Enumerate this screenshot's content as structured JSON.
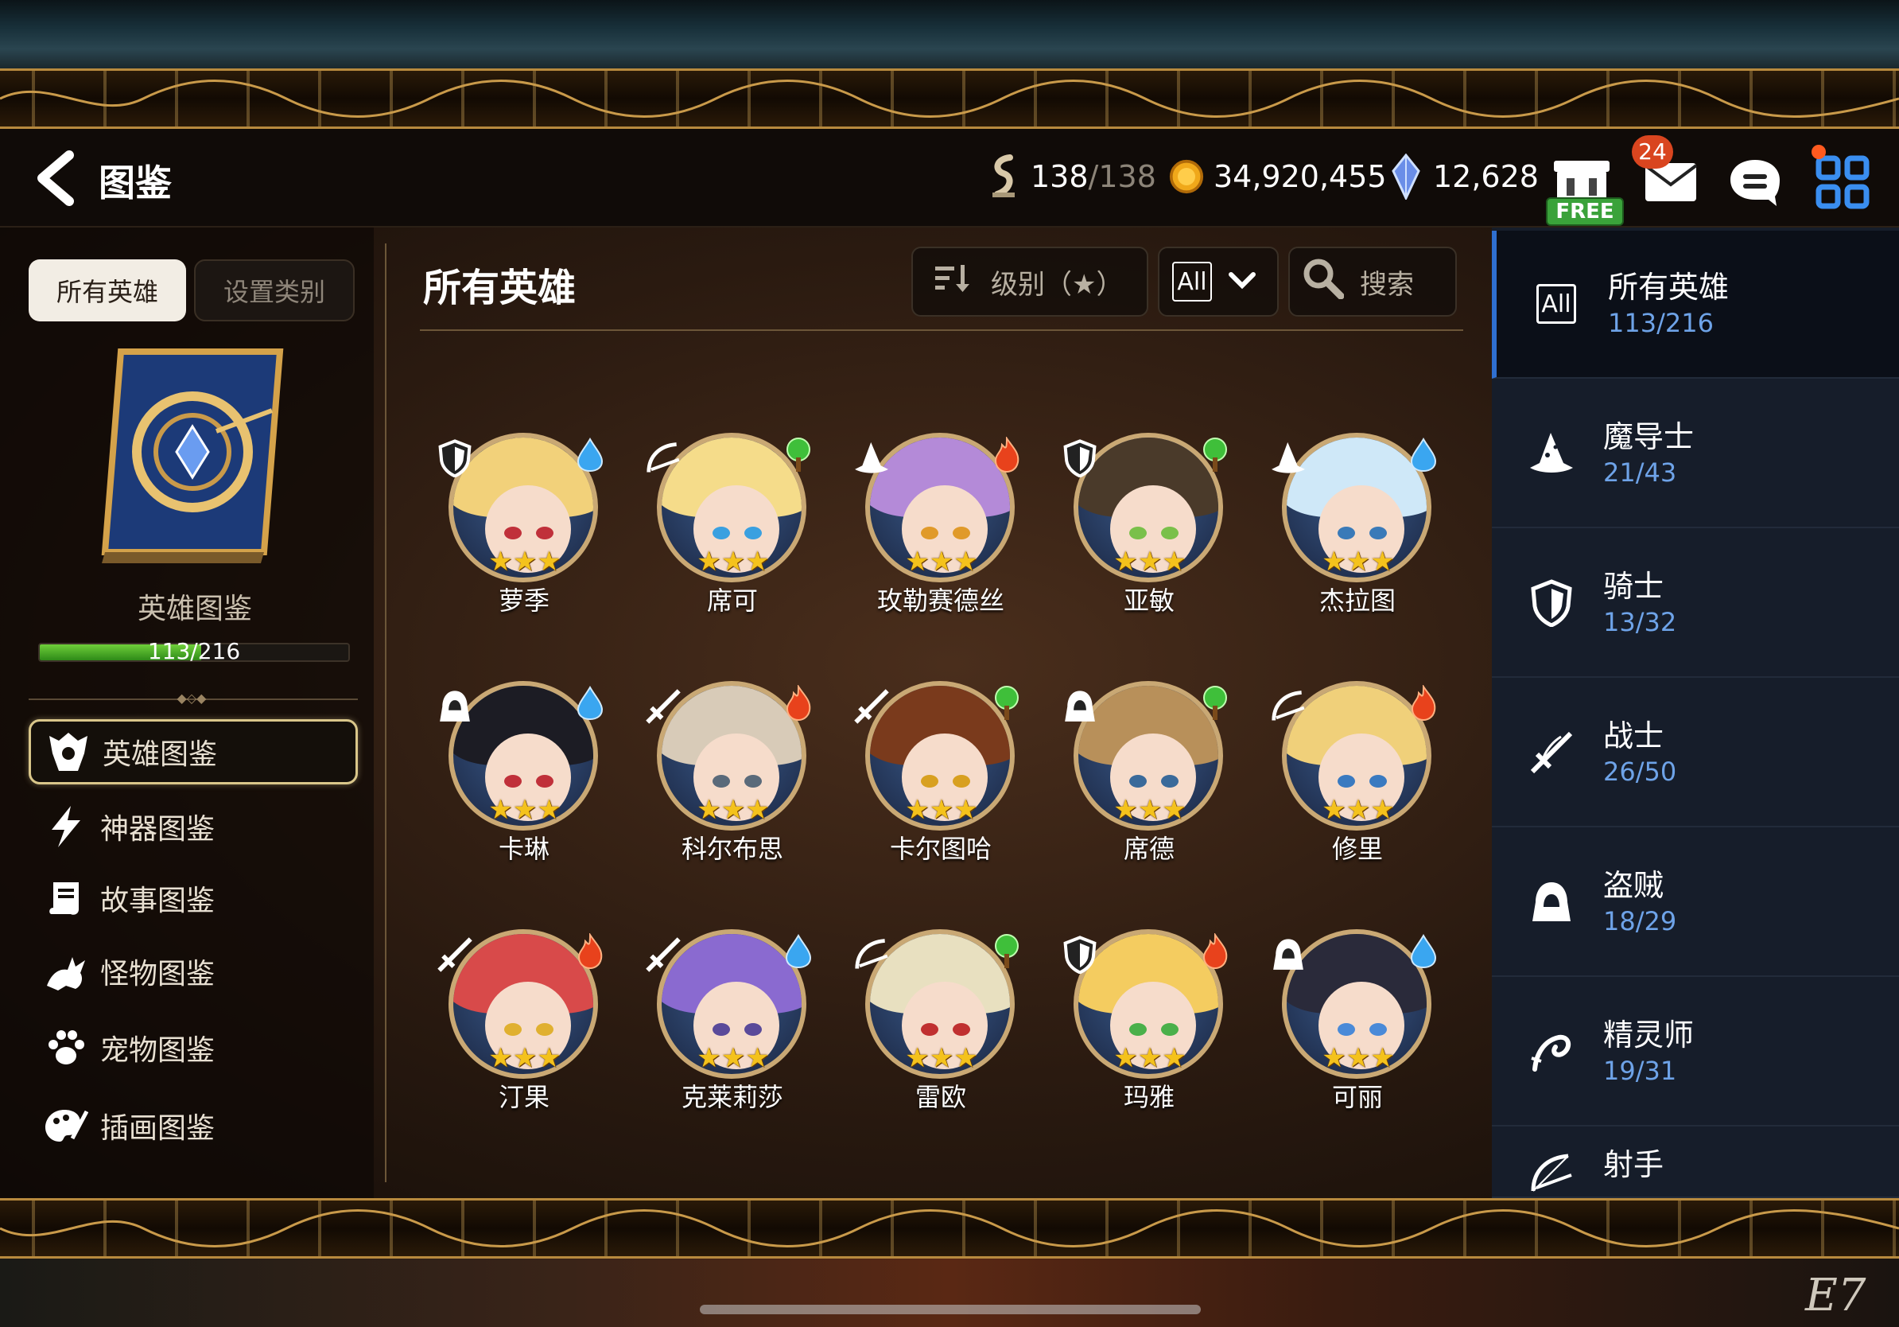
{
  "header": {
    "title": "图鉴",
    "stamina_current": "138",
    "stamina_max": "/138",
    "gold": "34,920,455",
    "gems": "12,628",
    "free_label": "FREE",
    "mail_badge": "24"
  },
  "left_panel": {
    "tabs": {
      "all": "所有英雄",
      "category": "设置类别"
    },
    "codex_label": "英雄图鉴",
    "progress_text": "113/216",
    "progress_fraction": 0.523,
    "nav": [
      {
        "label": "英雄图鉴",
        "icon": "hero-icon"
      },
      {
        "label": "神器图鉴",
        "icon": "lightning-icon"
      },
      {
        "label": "故事图鉴",
        "icon": "scroll-icon"
      },
      {
        "label": "怪物图鉴",
        "icon": "dragon-icon"
      },
      {
        "label": "宠物图鉴",
        "icon": "paw-icon"
      },
      {
        "label": "插画图鉴",
        "icon": "palette-icon"
      }
    ]
  },
  "center": {
    "title": "所有英雄",
    "sort_label": "级别（★）",
    "filter_label": "All",
    "search_label": "搜索"
  },
  "heroes": [
    {
      "name": "萝季",
      "class": "knight",
      "element": "ice",
      "stars": 3,
      "hair": "#f2d17a",
      "eye": "#c0303a"
    },
    {
      "name": "席可",
      "class": "ranger",
      "element": "earth",
      "stars": 3,
      "hair": "#f5dc8a",
      "eye": "#3aa0e0"
    },
    {
      "name": "玫勒赛德丝",
      "class": "mage",
      "element": "fire",
      "stars": 3,
      "hair": "#b48ad8",
      "eye": "#e09a2a"
    },
    {
      "name": "亚敏",
      "class": "knight",
      "element": "earth",
      "stars": 3,
      "hair": "#4a3a2a",
      "eye": "#7ac04a"
    },
    {
      "name": "杰拉图",
      "class": "mage",
      "element": "ice",
      "stars": 3,
      "hair": "#cfe8f8",
      "eye": "#3a7ab8"
    },
    {
      "name": "卡琳",
      "class": "thief",
      "element": "ice",
      "stars": 3,
      "hair": "#1c1c24",
      "eye": "#c0303a"
    },
    {
      "name": "科尔布思",
      "class": "warrior",
      "element": "fire",
      "stars": 3,
      "hair": "#d8cbb8",
      "eye": "#5a6a7a"
    },
    {
      "name": "卡尔图哈",
      "class": "warrior",
      "element": "earth",
      "stars": 3,
      "hair": "#7a3a1c",
      "eye": "#d8a020"
    },
    {
      "name": "席德",
      "class": "thief",
      "element": "earth",
      "stars": 3,
      "hair": "#b8905a",
      "eye": "#3a6a9a"
    },
    {
      "name": "修里",
      "class": "ranger",
      "element": "fire",
      "stars": 3,
      "hair": "#f0d07a",
      "eye": "#3a7ac0"
    },
    {
      "name": "汀果",
      "class": "warrior",
      "element": "fire",
      "stars": 3,
      "hair": "#d84a4a",
      "eye": "#e0b030"
    },
    {
      "name": "克莱莉莎",
      "class": "warrior",
      "element": "ice",
      "stars": 3,
      "hair": "#8a6ad0",
      "eye": "#5a4a9a"
    },
    {
      "name": "雷欧",
      "class": "ranger",
      "element": "earth",
      "stars": 3,
      "hair": "#e8e0c0",
      "eye": "#c03030"
    },
    {
      "name": "玛雅",
      "class": "knight",
      "element": "fire",
      "stars": 3,
      "hair": "#f4cc60",
      "eye": "#4ab04a"
    },
    {
      "name": "可丽",
      "class": "thief",
      "element": "ice",
      "stars": 3,
      "hair": "#2a2a3a",
      "eye": "#4a8ad8"
    }
  ],
  "categories": [
    {
      "label": "所有英雄",
      "count": "113/216",
      "icon": "all-icon"
    },
    {
      "label": "魔导士",
      "count": "21/43",
      "icon": "mage-hat-icon"
    },
    {
      "label": "骑士",
      "count": "13/32",
      "icon": "shield-icon"
    },
    {
      "label": "战士",
      "count": "26/50",
      "icon": "sword-icon"
    },
    {
      "label": "盗贼",
      "count": "18/29",
      "icon": "hood-icon"
    },
    {
      "label": "精灵师",
      "count": "19/31",
      "icon": "spirit-icon"
    },
    {
      "label": "射手",
      "count": "",
      "icon": "bow-icon"
    }
  ],
  "colors": {
    "accent_blue": "#2f6fd0",
    "count_blue": "#6ea3e8",
    "gold_border": "#c9a874",
    "star_gold": "#f4c21c",
    "progress_green": "#4eb02a",
    "badge_red": "#d9451f"
  },
  "footer": {
    "logo_text": "E7"
  }
}
